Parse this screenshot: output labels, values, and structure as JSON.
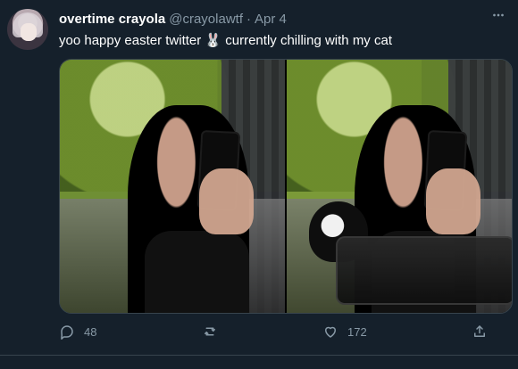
{
  "tweet": {
    "author": {
      "name": "overtime crayola",
      "handle": "@crayolawtf",
      "dot": "·",
      "date": "Apr 4"
    },
    "text": "yoo happy easter twitter 🐰 currently chilling with my cat",
    "actions": {
      "reply_count": "48",
      "like_count": "172"
    }
  }
}
